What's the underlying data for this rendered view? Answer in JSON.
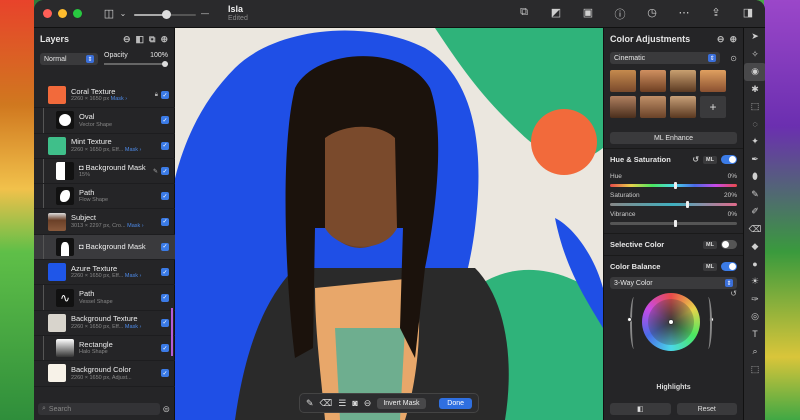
{
  "toolbar": {
    "title": "Isla",
    "subtitle": "Edited"
  },
  "layers_panel": {
    "title": "Layers",
    "blend_mode": "Normal",
    "opacity_label": "Opacity",
    "opacity_value": "100%",
    "items": [
      {
        "name": "Coral Texture",
        "sub": "2260 × 1650 px",
        "link": "Mask ›",
        "color": "#f26a3b",
        "child": false
      },
      {
        "name": "Oval",
        "sub": "Vector Shape",
        "link": "",
        "color": "#ffffff",
        "child": true
      },
      {
        "name": "Mint Texture",
        "sub": "2260 × 1650 px, Eff...",
        "link": "Mask ›",
        "color": "#3fbf8a",
        "child": false
      },
      {
        "name": "Background Mask",
        "sub": "15%",
        "link": "",
        "color": "#111111",
        "child": true
      },
      {
        "name": "Path",
        "sub": "Flow Shape",
        "link": "",
        "color": "#111111",
        "child": true
      },
      {
        "name": "Subject",
        "sub": "3013 × 2297 px, Cro...",
        "link": "Mask ›",
        "color": "#8a5a3c",
        "child": false
      },
      {
        "name": "Background Mask",
        "sub": "",
        "link": "",
        "color": "#222222",
        "child": true
      },
      {
        "name": "Azure Texture",
        "sub": "2260 × 1650 px, Eff...",
        "link": "Mask ›",
        "color": "#1f56e8",
        "child": false
      },
      {
        "name": "Path",
        "sub": "Vessel Shape",
        "link": "",
        "color": "#111111",
        "child": true
      },
      {
        "name": "Background Texture",
        "sub": "2260 × 1650 px, Eff...",
        "link": "Mask ›",
        "color": "#d8d4cc",
        "child": false
      },
      {
        "name": "Rectangle",
        "sub": "Halo Shape",
        "link": "",
        "color": "#cccccc",
        "child": true
      },
      {
        "name": "Background Color",
        "sub": "2260 × 1650 px, Adjust...",
        "link": "",
        "color": "#f7f2e8",
        "child": false
      }
    ],
    "search_placeholder": "Search"
  },
  "canvas": {
    "invert_mask_label": "Invert Mask",
    "done_label": "Done"
  },
  "adjustments": {
    "title": "Color Adjustments",
    "preset": "Cinematic",
    "ml_enhance": "ML Enhance",
    "hue_sat_title": "Hue & Saturation",
    "ml_tag": "ML",
    "hue_label": "Hue",
    "hue_value": "0%",
    "saturation_label": "Saturation",
    "saturation_value": "20%",
    "vibrance_label": "Vibrance",
    "vibrance_value": "0%",
    "selective_color": "Selective Color",
    "color_balance": "Color Balance",
    "balance_mode": "3-Way Color",
    "wheel_label": "Highlights",
    "reset_label": "Reset",
    "add_preset": "+"
  },
  "colors": {
    "accent": "#3b7be6",
    "window_bg": "#1c1c1e"
  }
}
